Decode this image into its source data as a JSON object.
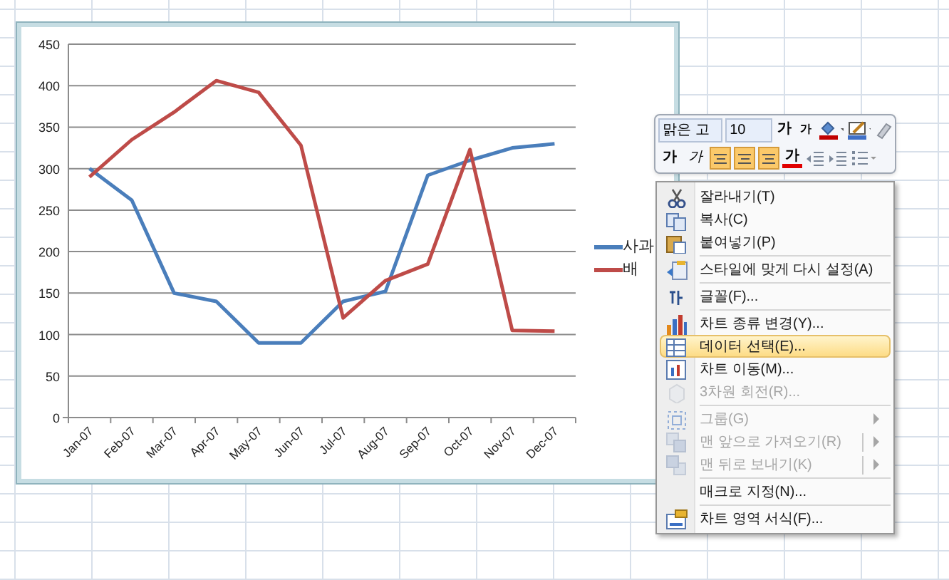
{
  "chart": {
    "chart_data": {
      "type": "line",
      "grid": true,
      "categories": [
        "Jan-07",
        "Feb-07",
        "Mar-07",
        "Apr-07",
        "May-07",
        "Jun-07",
        "Jul-07",
        "Aug-07",
        "Sep-07",
        "Oct-07",
        "Nov-07",
        "Dec-07"
      ],
      "ylim": [
        0,
        450
      ],
      "yticks": [
        0,
        50,
        100,
        150,
        200,
        250,
        300,
        350,
        400,
        450
      ],
      "series": [
        {
          "name": "사과",
          "color": "#4a7ebb",
          "values": [
            300,
            262,
            150,
            140,
            90,
            90,
            140,
            152,
            292,
            310,
            325,
            330
          ]
        },
        {
          "name": "배",
          "color": "#be4b48",
          "values": [
            290,
            335,
            368,
            406,
            392,
            328,
            120,
            165,
            185,
            323,
            105,
            104
          ]
        }
      ]
    }
  },
  "mini_toolbar": {
    "font": "맑은 고",
    "size": "10",
    "grow": "가",
    "shrink": "가",
    "bold": "가",
    "italic": "가",
    "font_color": "가",
    "align": [
      {
        "selected": true
      },
      {
        "selected": true
      },
      {
        "selected": true
      }
    ]
  },
  "context_menu": [
    {
      "kind": "item",
      "label": "잘라내기(T)",
      "disabled": false,
      "highlighted": false
    },
    {
      "kind": "item",
      "label": "복사(C)",
      "disabled": false,
      "highlighted": false
    },
    {
      "kind": "item",
      "label": "붙여넣기(P)",
      "disabled": false,
      "highlighted": false
    },
    {
      "kind": "separator"
    },
    {
      "kind": "item",
      "label": "스타일에 맞게 다시 설정(A)",
      "disabled": false,
      "highlighted": false
    },
    {
      "kind": "separator"
    },
    {
      "kind": "item",
      "label": "글꼴(F)...",
      "disabled": false,
      "highlighted": false
    },
    {
      "kind": "separator"
    },
    {
      "kind": "item",
      "label": "차트 종류 변경(Y)...",
      "disabled": false,
      "highlighted": false
    },
    {
      "kind": "item",
      "label": "데이터 선택(E)...",
      "disabled": false,
      "highlighted": true
    },
    {
      "kind": "item",
      "label": "차트 이동(M)...",
      "disabled": false,
      "highlighted": false
    },
    {
      "kind": "item",
      "label": "3차원 회전(R)...",
      "disabled": true,
      "highlighted": false
    },
    {
      "kind": "separator"
    },
    {
      "kind": "item",
      "label": "그룹(G)",
      "disabled": true,
      "highlighted": false,
      "submenu": true
    },
    {
      "kind": "item",
      "label": "맨 앞으로 가져오기(R)",
      "disabled": true,
      "highlighted": false,
      "submenu": true,
      "split": true
    },
    {
      "kind": "item",
      "label": "맨 뒤로 보내기(K)",
      "disabled": true,
      "highlighted": false,
      "submenu": true,
      "split": true
    },
    {
      "kind": "separator"
    },
    {
      "kind": "item",
      "label": "매크로 지정(N)...",
      "disabled": false,
      "highlighted": false
    },
    {
      "kind": "separator"
    },
    {
      "kind": "item",
      "label": "차트 영역 서식(F)...",
      "disabled": false,
      "highlighted": false
    }
  ]
}
